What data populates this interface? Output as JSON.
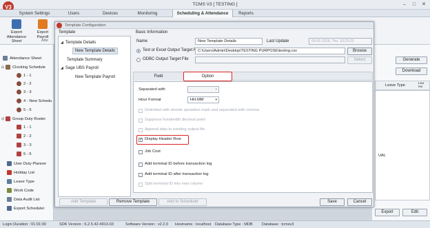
{
  "app": {
    "title": "TCMS V3 [ TESTING ]",
    "logo_text": "V3"
  },
  "menu": {
    "tabs": [
      {
        "label": "System Settings"
      },
      {
        "label": "Users"
      },
      {
        "label": "Devices"
      },
      {
        "label": "Monitoring"
      },
      {
        "label": "Scheduling & Attendance"
      },
      {
        "label": "Reports"
      }
    ]
  },
  "ribbon": {
    "buttons": [
      {
        "label": "Export Attendance Sheet"
      },
      {
        "label": "Export Payroll"
      }
    ],
    "group_label": "Atte"
  },
  "left_tree": {
    "items": [
      {
        "label": "Attendance Sheet"
      },
      {
        "label": "Clocking Schedule"
      },
      {
        "label": "1 - 1"
      },
      {
        "label": "2 - 2"
      },
      {
        "label": "3 - 3"
      },
      {
        "label": "4 - New Schedu"
      },
      {
        "label": "5 - 5"
      },
      {
        "label": "Group Duty Roster"
      },
      {
        "label": "1 - 1"
      },
      {
        "label": "2 - 2"
      },
      {
        "label": "3 - 3"
      },
      {
        "label": "5 - 5"
      },
      {
        "label": "User Duty Planner"
      },
      {
        "label": "Holiday List"
      },
      {
        "label": "Leave Type"
      },
      {
        "label": "Work Code"
      },
      {
        "label": "Data Audit List"
      },
      {
        "label": "Export Scheduler"
      }
    ]
  },
  "main_right": {
    "generate_label": "Generate",
    "download_label": "Download",
    "col_leave_type": "Leave Type",
    "col_lea_ho": "Lea Ho",
    "cell_ual": "UAL",
    "export_label": "Export",
    "edit_label": "Edit"
  },
  "status_bar": {
    "login_duration": "Login Duration : 01:01:00",
    "sdk_version": "SDK Version : 6.2.5.42-4913-03",
    "software_version": "Software Version : v2.2.0",
    "hostname": "Hostname : localhost",
    "database_type": "Database Type : MDB",
    "database": "Database : tcmsv3"
  },
  "dialog": {
    "title": "Template Configuration",
    "template_group_label": "Template",
    "tree": {
      "template_details": "Template Details",
      "new_template_details": "New Template Details",
      "template_summary": "Template Summary",
      "sage_ubs_payroll": "Sage UBS Payroll",
      "new_template_payroll": "New Template Payroll"
    },
    "basic_info": {
      "group_label": "Basic Information",
      "name_label": "Name",
      "name_value": "New Template Details",
      "last_update_label": "Last Update",
      "last_update_value": "09-01-2018, Thu. 10:23:23",
      "text_excel_label": "Text or Excel Output Target File",
      "text_excel_value": "C:\\Users\\Admin\\Desktop\\TESTING PURPOSE\\testing.csv",
      "browse_label": "Browse",
      "odbc_label": "ODBC Output Target File",
      "odbc_value": "",
      "select_label": "Select"
    },
    "tabs": [
      {
        "label": "Field"
      },
      {
        "label": "Option"
      }
    ],
    "options": {
      "separated_with_label": "Separated with",
      "separated_with_value": "",
      "hour_format_label": "Hour Format",
      "hour_format_value": "HH.MM",
      "checks": [
        {
          "label": "Delimited with double quotation mark and separated with comma",
          "checked": false,
          "enabled": false
        },
        {
          "label": "Suppress hundredth decimal point",
          "checked": false,
          "enabled": false
        },
        {
          "label": "Append data to existing output file",
          "checked": false,
          "enabled": false
        },
        {
          "label": "Display Header Row",
          "checked": true,
          "enabled": true
        },
        {
          "label": "Job Cost",
          "checked": false,
          "enabled": true
        },
        {
          "label": "Add terminal ID before transaction log",
          "checked": false,
          "enabled": true
        },
        {
          "label": "Add terminal ID after transaction log",
          "checked": false,
          "enabled": true
        },
        {
          "label": "Split terminal ID into new column",
          "checked": false,
          "enabled": false
        }
      ]
    },
    "buttons": {
      "add_template": "Add Template",
      "remove_template": "Remove Template",
      "add_to_scheduler": "Add to Scheduler",
      "save": "Save",
      "cancel": "Cancel"
    }
  }
}
